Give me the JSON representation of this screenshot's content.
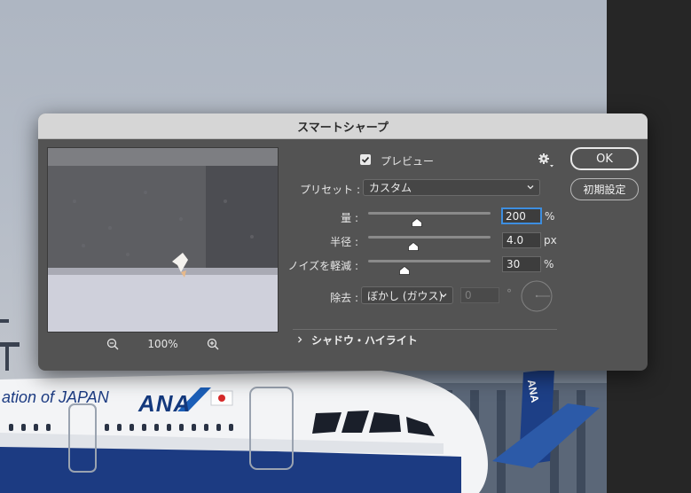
{
  "dialog": {
    "title": "スマートシャープ",
    "preview_checkbox_label": "プレビュー",
    "preview_checked": true,
    "preset_label": "プリセット :",
    "preset_value": "カスタム",
    "zoom_level": "100%",
    "amount": {
      "label": "量 :",
      "value": "200",
      "unit": "%",
      "level": 0.4
    },
    "radius": {
      "label": "半径 :",
      "value": "4.0",
      "unit": "px",
      "level": 0.37
    },
    "noise": {
      "label": "ノイズを軽減 :",
      "value": "30",
      "unit": "%",
      "level": 0.3
    },
    "remove_label": "除去 :",
    "remove_value": "ぼかし (ガウス)",
    "angle_value": "0",
    "angle_unit": "°",
    "shadow_highlight_label": "シャドウ・ハイライト",
    "ok_label": "OK",
    "reset_label": "初期設定"
  },
  "photo": {
    "livery_text": "ation of JAPAN",
    "logo_text": "ANA",
    "tail_text": "ANA"
  },
  "colors": {
    "dialog_bg": "#535353",
    "titlebar_bg": "#d6d6d6",
    "focus_ring": "#3d8ee0",
    "ana_blue": "#14397d"
  },
  "icons": [
    "zoom-out-icon",
    "zoom-in-icon",
    "gear-icon",
    "checkmark-icon",
    "chevron-down-icon",
    "chevron-right-icon",
    "angle-dial-icon",
    "slider-thumb-icon"
  ]
}
